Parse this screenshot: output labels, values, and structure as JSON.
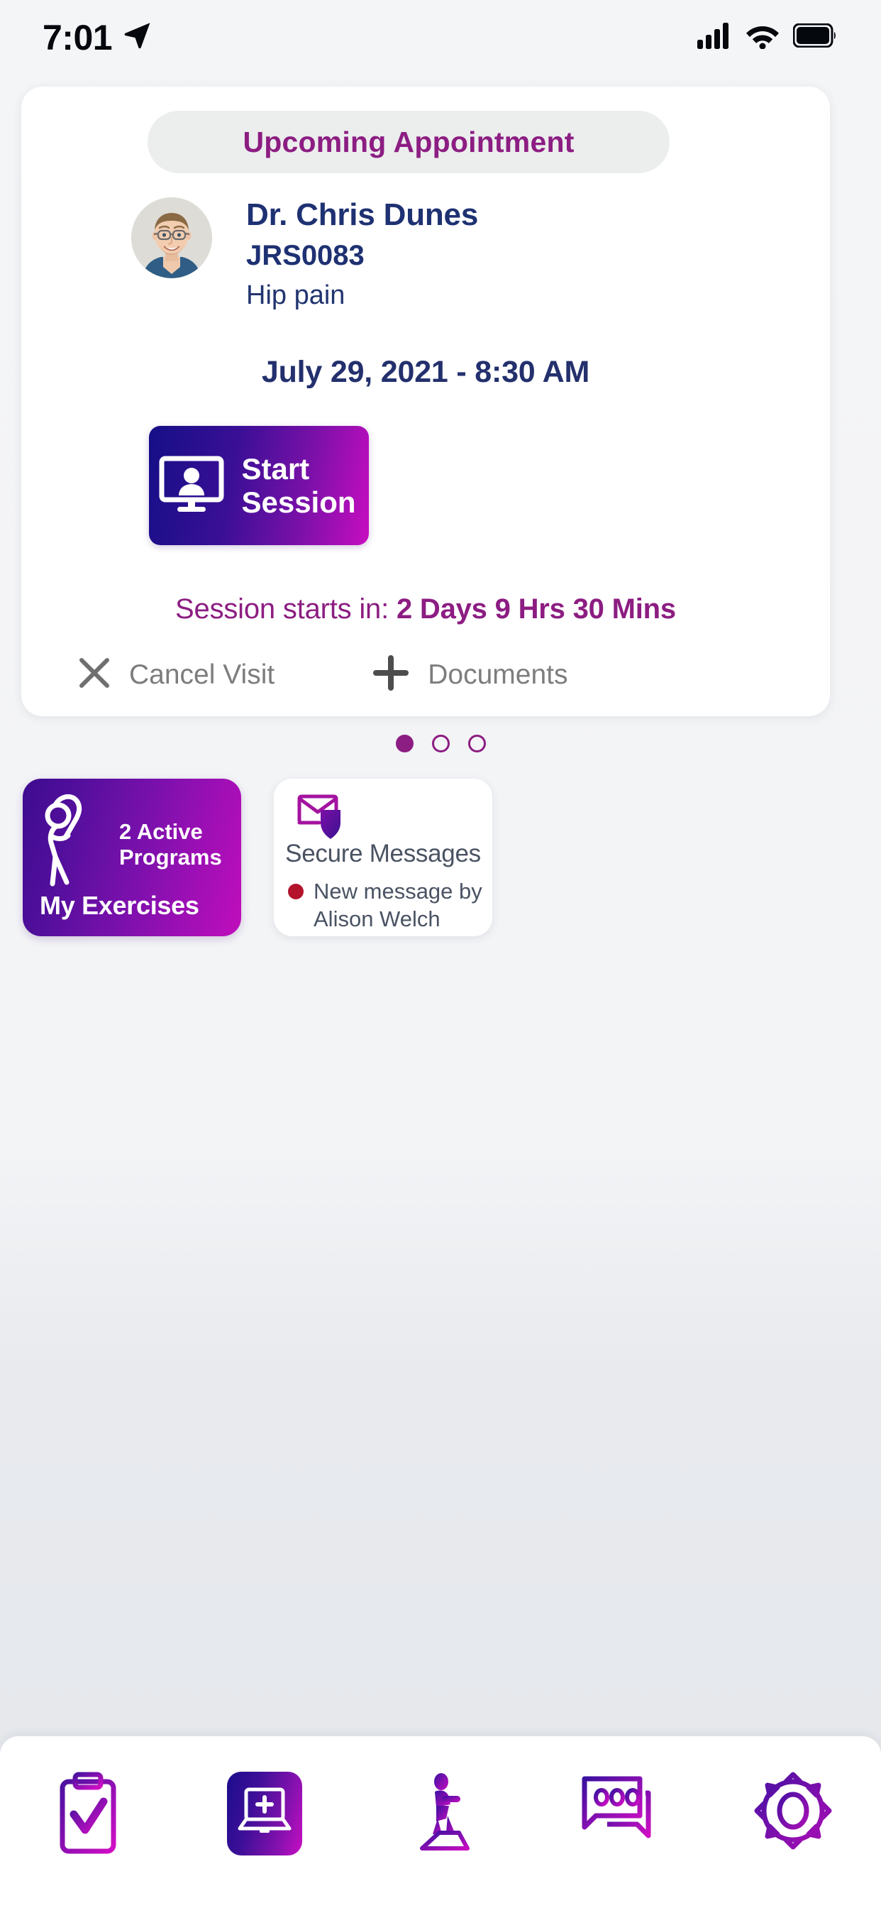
{
  "status_bar": {
    "time": "7:01",
    "location_icon": "location-arrow-icon",
    "signal_icon": "cellular-signal-icon",
    "wifi_icon": "wifi-icon",
    "battery_icon": "battery-full-icon"
  },
  "appointment": {
    "badge": "Upcoming Appointment",
    "doctor_name": "Dr. Chris Dunes",
    "doctor_id": "JRS0083",
    "reason": "Hip pain",
    "datetime": "July 29, 2021 - 8:30 AM",
    "start_button": {
      "line1": "Start",
      "line2": "Session",
      "icon": "video-session-icon"
    },
    "countdown_label": "Session starts in: ",
    "countdown_value": "2 Days 9 Hrs 30 Mins",
    "cancel": {
      "label": "Cancel Visit",
      "icon": "close-x-icon"
    },
    "documents": {
      "label": "Documents",
      "icon": "plus-icon"
    }
  },
  "carousel": {
    "total": 3,
    "active_index": 0
  },
  "exercises_card": {
    "icon": "stretching-person-icon",
    "count_line1": "2 Active",
    "count_line2": "Programs",
    "title": "My Exercises"
  },
  "messages_card": {
    "icon": "secure-envelope-shield-icon",
    "title": "Secure Messages",
    "status_dot_color": "#b3132b",
    "notice_line1": "New message by",
    "notice_line2": "Alison Welch"
  },
  "bottom_nav": {
    "items": [
      {
        "name": "checklist",
        "icon": "clipboard-check-icon",
        "active": false
      },
      {
        "name": "visits",
        "icon": "laptop-plus-icon",
        "active": true
      },
      {
        "name": "exercises",
        "icon": "exercise-person-icon",
        "active": false
      },
      {
        "name": "messages",
        "icon": "chat-bubbles-icon",
        "active": false
      },
      {
        "name": "settings",
        "icon": "gear-icon",
        "active": false
      }
    ]
  },
  "colors": {
    "purple": "#8c1d82",
    "navy": "#1e3172",
    "gradient_start": "#150f86",
    "gradient_end": "#c70ec0",
    "gray_text": "#7d7d7d",
    "page_bg": "#f4f5f7"
  }
}
